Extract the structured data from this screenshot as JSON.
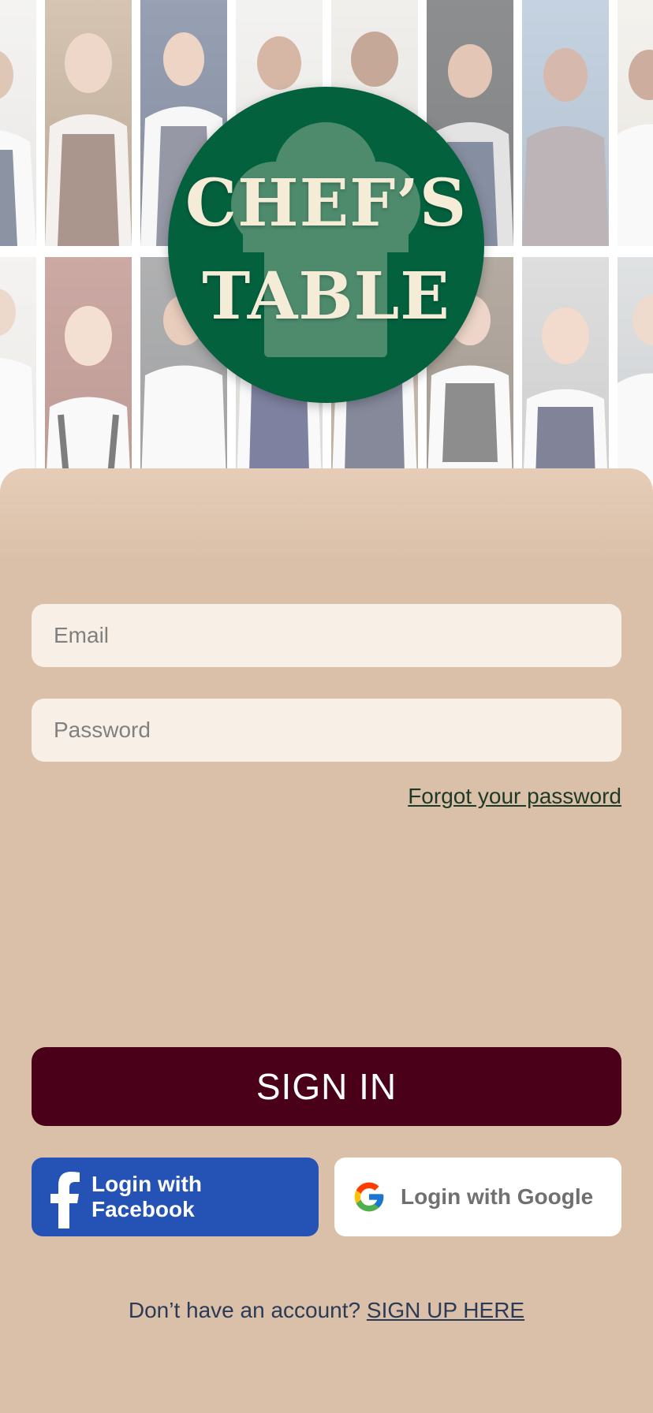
{
  "logo": {
    "line1": "CHEF’S",
    "line2": "TABLE"
  },
  "form": {
    "email_placeholder": "Email",
    "password_placeholder": "Password",
    "forgot_label": "Forgot your password",
    "signin_label": "SIGN IN"
  },
  "social": {
    "facebook_label": "Login with Facebook",
    "google_label": "Login with Google"
  },
  "footer": {
    "prompt": "Don’t have an account?",
    "signup_label": "SIGN UP HERE"
  },
  "colors": {
    "logo_green": "#03613e",
    "panel_tan": "#dac0a8",
    "signin_maroon": "#4a0019",
    "facebook_blue": "#2553b5"
  }
}
